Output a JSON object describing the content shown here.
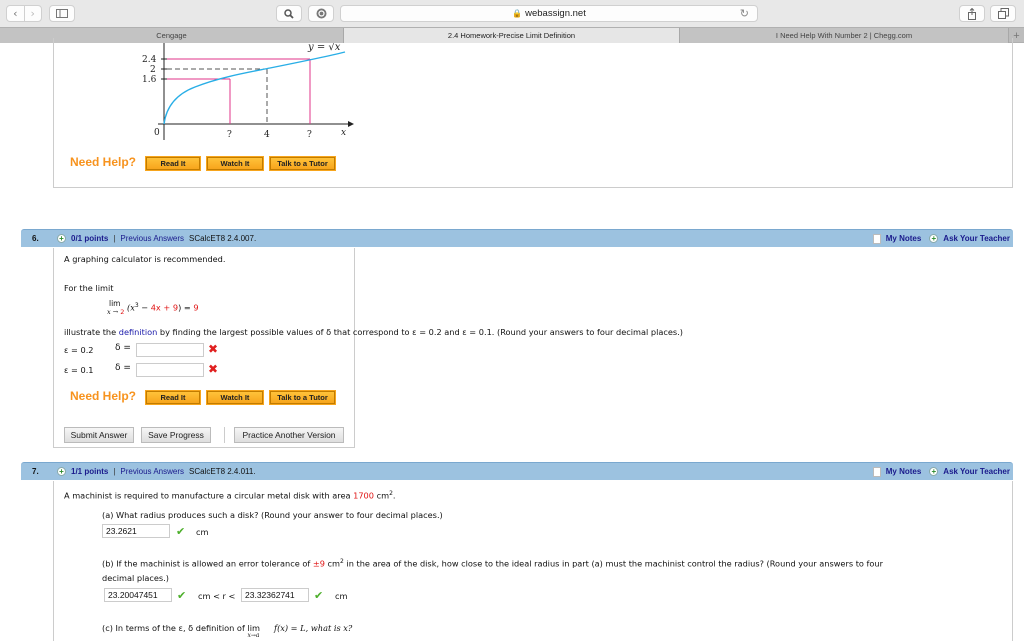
{
  "browser": {
    "address": "webassign.net",
    "tabs": [
      {
        "label": "Cengage",
        "active": false
      },
      {
        "label": "2.4 Homework-Precise Limit Definition",
        "active": true
      },
      {
        "label": "I Need Help With Number 2 | Chegg.com",
        "active": false
      }
    ],
    "new_tab": "+",
    "icons": {
      "back": "‹",
      "forward": "›",
      "search": "⌕",
      "reload": "↻"
    }
  },
  "graph": {
    "curve_label": "y = √x",
    "y_ticks": [
      "2.4",
      "2",
      "1.6"
    ],
    "x_ticks": [
      "0",
      "?",
      "4",
      "?",
      "x"
    ],
    "colors": {
      "curve": "#29aee6",
      "guides": "#e0338a",
      "dashed": "#555555"
    }
  },
  "help": {
    "label": "Need Help?",
    "read": "Read It",
    "watch": "Watch It",
    "tutor": "Talk to a Tutor"
  },
  "q6": {
    "number": "6.",
    "points": "0/1 points",
    "previous": "Previous Answers",
    "code": "SCalcET8 2.4.007.",
    "my_notes": "My Notes",
    "ask": "Ask Your Teacher",
    "intro": "A graphing calculator is recommended.",
    "for_limit": "For the limit",
    "lim": "lim",
    "lim_sub_x": "x → ",
    "lim_sub_a": "2",
    "expr_a": "(x",
    "expr_exp": "3",
    "expr_b": " − ",
    "expr_c": "4x + 9",
    "expr_d": ") = ",
    "expr_e": "9",
    "illustrate_a": "illustrate the ",
    "definition_link": "definition",
    "illustrate_b": " by finding the largest possible values of δ that correspond to ε = 0.2 and ε = 0.1. (Round your answers to four decimal places.)",
    "rows": [
      {
        "eps": "ε = 0.2",
        "delta": "δ =",
        "value": "",
        "status": "incorrect"
      },
      {
        "eps": "ε = 0.1",
        "delta": "δ =",
        "value": "",
        "status": "incorrect"
      }
    ],
    "submit": "Submit Answer",
    "save": "Save Progress",
    "practice": "Practice Another Version"
  },
  "q7": {
    "number": "7.",
    "points": "1/1 points",
    "previous": "Previous Answers",
    "code": "SCalcET8 2.4.011.",
    "my_notes": "My Notes",
    "ask": "Ask Your Teacher",
    "intro_a": "A machinist is required to manufacture a circular metal disk with area ",
    "area": "1700",
    "intro_b": " cm",
    "a_prompt": "(a) What radius produces such a disk? (Round your answer to four decimal places.)",
    "a_value": "23.2621",
    "a_unit": "cm",
    "b_prompt_a": "(b) If the machinist is allowed an error tolerance of ",
    "tolerance": "±9",
    "b_prompt_b": " cm",
    "b_prompt_c": " in the area of the disk, how close to the ideal radius in part (a) must the machinist control the radius? (Round your answers to four",
    "b_prompt_d": "decimal places.)",
    "b_low": "23.20047451",
    "b_mid": "cm < r <",
    "b_high": "23.32362741",
    "b_unit": "cm",
    "c_prompt_a": "(c) In terms of the ε, δ definition of ",
    "c_lim": "lim",
    "c_sub": "x→a",
    "c_prompt_b": " f(x) = L,  what is x?"
  }
}
